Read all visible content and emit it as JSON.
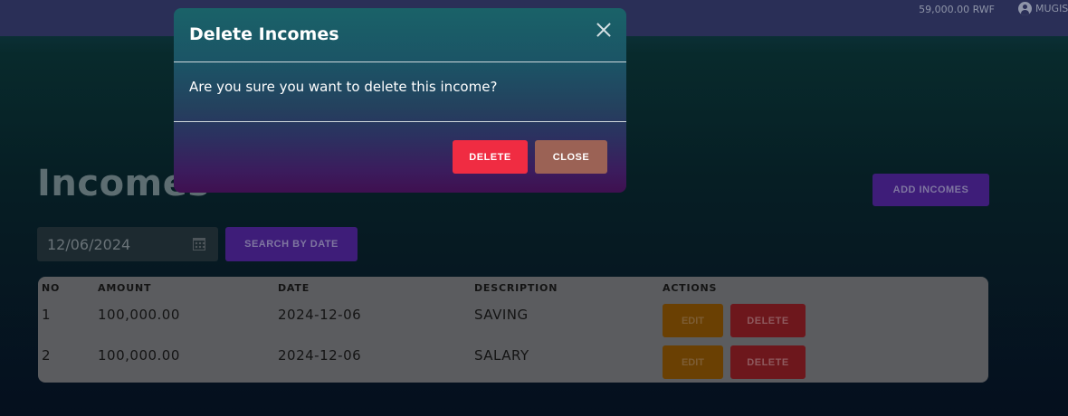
{
  "topbar": {
    "balance": "59,000.00 RWF",
    "user_name": "MUGIS"
  },
  "page": {
    "title": "Incomes",
    "add_button": "ADD INCOMES",
    "date_value": "12/06/2024",
    "search_button": "SEARCH BY DATE"
  },
  "table": {
    "headers": [
      "NO",
      "AMOUNT",
      "DATE",
      "DESCRIPTION",
      "ACTIONS"
    ],
    "rows": [
      {
        "no": "1",
        "amount": "100,000.00",
        "date": "2024-12-06",
        "description": "SAVING",
        "edit": "EDIT",
        "delete": "DELETE"
      },
      {
        "no": "2",
        "amount": "100,000.00",
        "date": "2024-12-06",
        "description": "SALARY",
        "edit": "EDIT",
        "delete": "DELETE"
      }
    ]
  },
  "modal": {
    "title": "Delete Incomes",
    "message": "Are you sure you want to delete this income?",
    "delete_label": "DELETE",
    "close_label": "CLOSE"
  },
  "colors": {
    "delete_accent": "#f02c42",
    "close_accent": "#9b6255",
    "primary_purple": "#3e1d79"
  }
}
